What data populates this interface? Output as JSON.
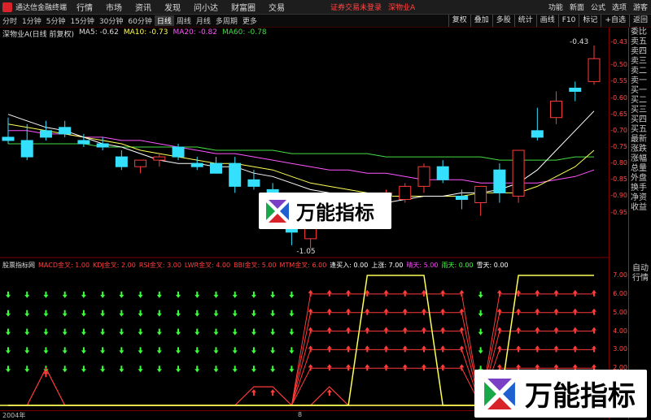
{
  "topbar": {
    "app_title": "通达信金融终端",
    "menu": [
      "行情",
      "市场",
      "资讯",
      "发现",
      "问小达",
      "财富圈",
      "交易"
    ],
    "warning": "证券交易未登录",
    "stock": "深物业A",
    "right": [
      "功能",
      "新面",
      "公式",
      "选项",
      "游客"
    ]
  },
  "toolbar": {
    "periods": [
      "分时",
      "1分钟",
      "5分钟",
      "15分钟",
      "30分钟",
      "60分钟",
      "日线",
      "周线",
      "月线",
      "多周期",
      "更多"
    ],
    "active_period": "日线",
    "right_buttons": [
      "复权",
      "叠加",
      "多股",
      "统计",
      "画线",
      "F10",
      "标记",
      "+自选",
      "返回"
    ]
  },
  "info": {
    "title": "深物业A(日线 前复权)",
    "ma5": "MA5: -0.62",
    "ma10": "MA10: -0.73",
    "ma20": "MA20: -0.82",
    "ma60": "MA60: -0.78"
  },
  "yaxis_main": [
    "-0.43",
    "-0.50",
    "-0.55",
    "-0.60",
    "-0.65",
    "-0.70",
    "-0.75",
    "-0.80",
    "-0.85",
    "-0.90",
    "-0.95"
  ],
  "yaxis_ind": [
    "7.00",
    "6.00",
    "5.00",
    "4.00",
    "3.00",
    "2.00",
    "1.00"
  ],
  "annotations": {
    "high": "-0.43",
    "low": "-1.05"
  },
  "indicator": {
    "name": "股票指标网",
    "items": [
      {
        "label": "MACD金叉: 1.00",
        "color": "#ff4040"
      },
      {
        "label": "KDJ金叉: 2.00",
        "color": "#ff4040"
      },
      {
        "label": "RSI金叉: 3.00",
        "color": "#ff4040"
      },
      {
        "label": "LWR金叉: 4.00",
        "color": "#ff4040"
      },
      {
        "label": "BBI金叉: 5.00",
        "color": "#ff4040"
      },
      {
        "label": "MTM金叉: 6.00",
        "color": "#ff4040"
      },
      {
        "label": "逢买入: 0.00",
        "color": "#ffffff"
      },
      {
        "label": "上涨: 7.00",
        "color": "#ffffff"
      },
      {
        "label": "晴天: 5.00",
        "color": "#ff40ff"
      },
      {
        "label": "雨天: 0.00",
        "color": "#40ff40"
      },
      {
        "label": "雪天: 0.00",
        "color": "#ffffff"
      }
    ]
  },
  "rightside": [
    "委比",
    "卖五",
    "卖四",
    "卖三",
    "卖二",
    "卖一",
    "买一",
    "买二",
    "买三",
    "买四",
    "买五",
    "最新",
    "涨跌",
    "涨幅",
    "总量",
    "外盘",
    "换手",
    "净资",
    "收益"
  ],
  "rightside_bottom": [
    "自动",
    "行情"
  ],
  "date_labels": [
    "2004年",
    "8"
  ],
  "watermark": "万能指标",
  "colors": {
    "up": "#ff3b3b",
    "down": "#35e0ff",
    "ma5": "#ffffff",
    "ma10": "#ffff55",
    "ma20": "#ff55ff",
    "ma60": "#44dd44"
  },
  "chart_data": {
    "type": "candlestick",
    "y_range": [
      -1.08,
      -0.42
    ],
    "candles": [
      {
        "o": -0.72,
        "h": -0.66,
        "l": -0.74,
        "c": -0.73
      },
      {
        "o": -0.73,
        "h": -0.68,
        "l": -0.79,
        "c": -0.78
      },
      {
        "o": -0.7,
        "h": -0.67,
        "l": -0.73,
        "c": -0.72
      },
      {
        "o": -0.69,
        "h": -0.67,
        "l": -0.72,
        "c": -0.71
      },
      {
        "o": -0.73,
        "h": -0.71,
        "l": -0.75,
        "c": -0.74
      },
      {
        "o": -0.74,
        "h": -0.72,
        "l": -0.76,
        "c": -0.75
      },
      {
        "o": -0.78,
        "h": -0.76,
        "l": -0.82,
        "c": -0.81
      },
      {
        "o": -0.81,
        "h": -0.79,
        "l": -0.83,
        "c": -0.79
      },
      {
        "o": -0.79,
        "h": -0.77,
        "l": -0.81,
        "c": -0.78
      },
      {
        "o": -0.75,
        "h": -0.74,
        "l": -0.79,
        "c": -0.78
      },
      {
        "o": -0.8,
        "h": -0.78,
        "l": -0.82,
        "c": -0.81
      },
      {
        "o": -0.8,
        "h": -0.78,
        "l": -0.83,
        "c": -0.83
      },
      {
        "o": -0.8,
        "h": -0.78,
        "l": -0.89,
        "c": -0.87
      },
      {
        "o": -0.85,
        "h": -0.82,
        "l": -0.88,
        "c": -0.87
      },
      {
        "o": -0.88,
        "h": -0.86,
        "l": -0.92,
        "c": -0.92
      },
      {
        "o": -0.93,
        "h": -0.9,
        "l": -1.05,
        "c": -1.01
      },
      {
        "o": -1.03,
        "h": -0.98,
        "l": -1.06,
        "c": -0.99
      },
      {
        "o": -0.95,
        "h": -0.9,
        "l": -0.99,
        "c": -0.93
      },
      {
        "o": -0.94,
        "h": -0.91,
        "l": -0.97,
        "c": -0.92
      },
      {
        "o": -0.92,
        "h": -0.89,
        "l": -0.95,
        "c": -0.91
      },
      {
        "o": -0.9,
        "h": -0.88,
        "l": -0.93,
        "c": -0.89
      },
      {
        "o": -0.91,
        "h": -0.86,
        "l": -0.92,
        "c": -0.87
      },
      {
        "o": -0.87,
        "h": -0.8,
        "l": -0.89,
        "c": -0.81
      },
      {
        "o": -0.81,
        "h": -0.79,
        "l": -0.86,
        "c": -0.85
      },
      {
        "o": -0.9,
        "h": -0.88,
        "l": -0.94,
        "c": -0.91
      },
      {
        "o": -0.92,
        "h": -0.88,
        "l": -0.96,
        "c": -0.87
      },
      {
        "o": -0.82,
        "h": -0.8,
        "l": -0.92,
        "c": -0.89
      },
      {
        "o": -0.9,
        "h": -0.8,
        "l": -0.92,
        "c": -0.76
      },
      {
        "o": -0.7,
        "h": -0.63,
        "l": -0.73,
        "c": -0.72
      },
      {
        "o": -0.66,
        "h": -0.58,
        "l": -0.68,
        "c": -0.61
      },
      {
        "o": -0.57,
        "h": -0.55,
        "l": -0.61,
        "c": -0.58
      },
      {
        "o": -0.55,
        "h": -0.44,
        "l": -0.56,
        "c": -0.48
      }
    ],
    "ma5": [
      -0.65,
      -0.67,
      -0.69,
      -0.7,
      -0.72,
      -0.74,
      -0.75,
      -0.77,
      -0.79,
      -0.8,
      -0.8,
      -0.81,
      -0.81,
      -0.83,
      -0.84,
      -0.86,
      -0.88,
      -0.89,
      -0.9,
      -0.91,
      -0.92,
      -0.91,
      -0.9,
      -0.9,
      -0.89,
      -0.89,
      -0.88,
      -0.86,
      -0.82,
      -0.76,
      -0.7,
      -0.64
    ],
    "ma10": [
      -0.68,
      -0.69,
      -0.7,
      -0.71,
      -0.72,
      -0.73,
      -0.74,
      -0.76,
      -0.77,
      -0.78,
      -0.79,
      -0.8,
      -0.8,
      -0.81,
      -0.82,
      -0.84,
      -0.86,
      -0.87,
      -0.88,
      -0.89,
      -0.9,
      -0.9,
      -0.9,
      -0.9,
      -0.9,
      -0.89,
      -0.89,
      -0.89,
      -0.87,
      -0.84,
      -0.81,
      -0.76
    ],
    "ma20": [
      -0.7,
      -0.7,
      -0.71,
      -0.71,
      -0.72,
      -0.72,
      -0.73,
      -0.73,
      -0.74,
      -0.75,
      -0.76,
      -0.77,
      -0.77,
      -0.78,
      -0.79,
      -0.8,
      -0.81,
      -0.82,
      -0.82,
      -0.83,
      -0.83,
      -0.84,
      -0.85,
      -0.85,
      -0.85,
      -0.86,
      -0.86,
      -0.86,
      -0.86,
      -0.85,
      -0.84,
      -0.82
    ],
    "ma60": [
      -0.74,
      -0.74,
      -0.74,
      -0.74,
      -0.74,
      -0.75,
      -0.75,
      -0.75,
      -0.75,
      -0.75,
      -0.75,
      -0.76,
      -0.76,
      -0.76,
      -0.76,
      -0.77,
      -0.77,
      -0.77,
      -0.77,
      -0.77,
      -0.78,
      -0.78,
      -0.78,
      -0.78,
      -0.78,
      -0.78,
      -0.79,
      -0.79,
      -0.79,
      -0.79,
      -0.78,
      -0.78
    ],
    "indicator_lines": {
      "up_trend": [
        0,
        0,
        0,
        0,
        0,
        0,
        0,
        0,
        0,
        0,
        0,
        0,
        0,
        0,
        0,
        0,
        0,
        0,
        0,
        7,
        7,
        7,
        7,
        0,
        0,
        0,
        0,
        7,
        7,
        7,
        7,
        7
      ],
      "signal": [
        0,
        0,
        2,
        0,
        0,
        0,
        0,
        0,
        0,
        0,
        0,
        0,
        0,
        1,
        1,
        0,
        0,
        1,
        0,
        0,
        0,
        0,
        0,
        0,
        0,
        0,
        0,
        0,
        0,
        0,
        0,
        0
      ],
      "mtm": [
        0,
        0,
        0,
        0,
        0,
        0,
        0,
        0,
        0,
        0,
        0,
        0,
        0,
        0,
        0,
        0,
        6,
        6,
        6,
        6,
        6,
        6,
        6,
        6,
        6,
        0,
        6,
        6,
        6,
        6,
        6,
        6
      ],
      "bbi": [
        0,
        0,
        0,
        0,
        0,
        0,
        0,
        0,
        0,
        0,
        0,
        0,
        0,
        0,
        0,
        0,
        5,
        5,
        5,
        5,
        5,
        5,
        5,
        5,
        5,
        0,
        5,
        5,
        5,
        5,
        5,
        5
      ],
      "lwr": [
        0,
        0,
        0,
        0,
        0,
        0,
        0,
        0,
        0,
        0,
        0,
        0,
        0,
        0,
        0,
        0,
        4,
        4,
        4,
        4,
        4,
        4,
        4,
        4,
        4,
        0,
        4,
        4,
        4,
        4,
        4,
        4
      ],
      "rsi": [
        0,
        0,
        0,
        0,
        0,
        0,
        0,
        0,
        0,
        0,
        0,
        0,
        0,
        0,
        0,
        0,
        3,
        3,
        3,
        3,
        3,
        3,
        3,
        3,
        3,
        0,
        3,
        3,
        3,
        3,
        3,
        3
      ],
      "kdj": [
        0,
        0,
        0,
        0,
        0,
        0,
        0,
        0,
        0,
        0,
        0,
        0,
        0,
        0,
        0,
        0,
        2,
        2,
        2,
        2,
        2,
        2,
        2,
        2,
        2,
        0,
        2,
        2,
        2,
        2,
        2,
        2
      ]
    }
  }
}
